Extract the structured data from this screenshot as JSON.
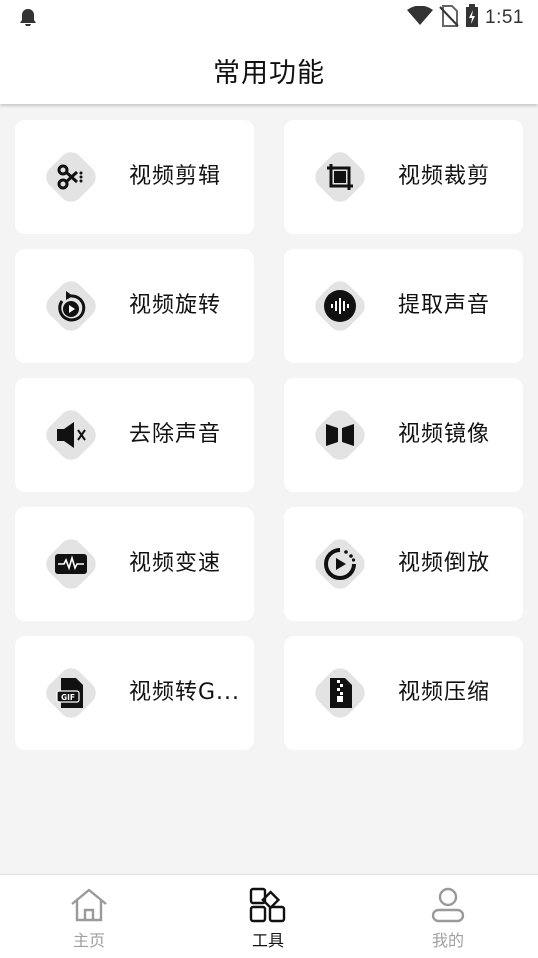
{
  "status_bar": {
    "time": "1:51"
  },
  "header": {
    "title": "常用功能"
  },
  "tools": [
    {
      "label": "视频剪辑",
      "icon": "scissors-icon"
    },
    {
      "label": "视频裁剪",
      "icon": "crop-icon"
    },
    {
      "label": "视频旋转",
      "icon": "rotate-icon"
    },
    {
      "label": "提取声音",
      "icon": "audio-wave-icon"
    },
    {
      "label": "去除声音",
      "icon": "mute-icon"
    },
    {
      "label": "视频镜像",
      "icon": "mirror-icon"
    },
    {
      "label": "视频变速",
      "icon": "speed-icon"
    },
    {
      "label": "视频倒放",
      "icon": "reverse-play-icon"
    },
    {
      "label": "视频转G...",
      "icon": "gif-icon"
    },
    {
      "label": "视频压缩",
      "icon": "zip-icon"
    }
  ],
  "bottom_nav": [
    {
      "label": "主页",
      "icon": "home-icon",
      "active": false
    },
    {
      "label": "工具",
      "icon": "tools-grid-icon",
      "active": true
    },
    {
      "label": "我的",
      "icon": "user-icon",
      "active": false
    }
  ],
  "colors": {
    "accent": "#111111",
    "inactive": "#a0a0a0",
    "blob": "#e3e3e3",
    "background": "#f4f4f4"
  }
}
